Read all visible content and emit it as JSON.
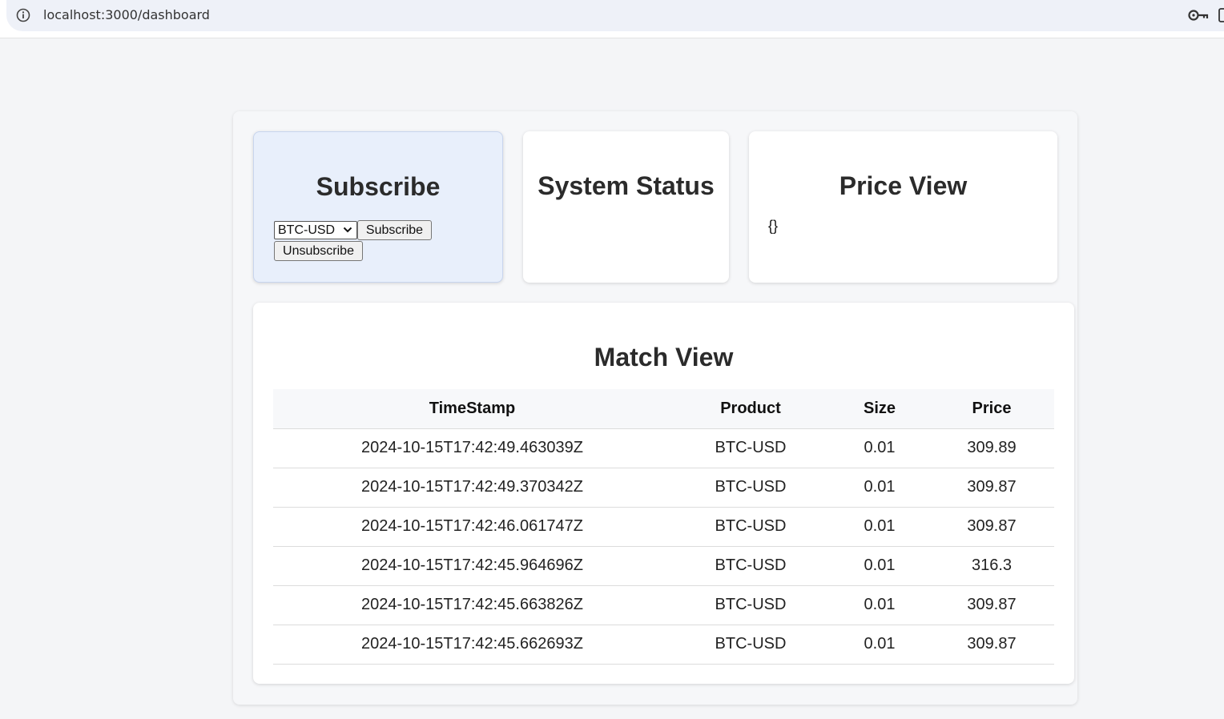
{
  "browser": {
    "url": "localhost:3000/dashboard",
    "icons": {
      "site_info": "info-icon",
      "password": "key-icon"
    }
  },
  "subscribe": {
    "title": "Subscribe",
    "product_selected": "BTC-USD",
    "subscribe_label": "Subscribe",
    "unsubscribe_label": "Unsubscribe"
  },
  "status": {
    "title": "System Status"
  },
  "price": {
    "title": "Price View",
    "content": "{}"
  },
  "match": {
    "title": "Match View",
    "columns": [
      "TimeStamp",
      "Product",
      "Size",
      "Price"
    ],
    "rows": [
      [
        "2024-10-15T17:42:49.463039Z",
        "BTC-USD",
        "0.01",
        "309.89"
      ],
      [
        "2024-10-15T17:42:49.370342Z",
        "BTC-USD",
        "0.01",
        "309.87"
      ],
      [
        "2024-10-15T17:42:46.061747Z",
        "BTC-USD",
        "0.01",
        "309.87"
      ],
      [
        "2024-10-15T17:42:45.964696Z",
        "BTC-USD",
        "0.01",
        "316.3"
      ],
      [
        "2024-10-15T17:42:45.663826Z",
        "BTC-USD",
        "0.01",
        "309.87"
      ],
      [
        "2024-10-15T17:42:45.662693Z",
        "BTC-USD",
        "0.01",
        "309.87"
      ]
    ]
  },
  "colors": {
    "page_bg": "#f4f5f7",
    "subscribe_card_bg": "#e8effb",
    "card_bg": "#ffffff",
    "table_header_bg": "#f7f8fa"
  }
}
